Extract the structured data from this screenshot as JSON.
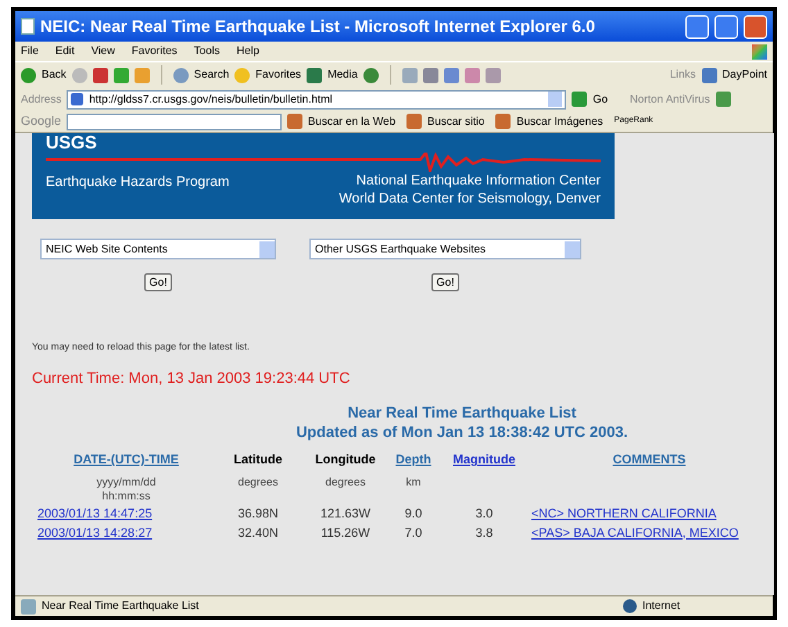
{
  "window": {
    "title": "NEIC: Near Real Time Earthquake List - Microsoft Internet Explorer 6.0"
  },
  "menu": [
    "File",
    "Edit",
    "View",
    "Favorites",
    "Tools",
    "Help"
  ],
  "toolbar": {
    "back": "Back",
    "search": "Search",
    "favorites": "Favorites",
    "media": "Media",
    "links_label": "Links",
    "links_item": "DayPoint"
  },
  "address_bar": {
    "label": "Address",
    "url": "http://gldss7.cr.usgs.gov/neis/bulletin/bulletin.html",
    "go": "Go",
    "norton": "Norton AntiVirus"
  },
  "google_bar": {
    "logo": "Google",
    "buttons": [
      "Buscar en la Web",
      "Buscar sitio",
      "Buscar Imágenes"
    ],
    "pagerank": "PageRank"
  },
  "banner": {
    "logo": "USGS",
    "program": "Earthquake Hazards Program",
    "center_lines": [
      "National Earthquake Information Center",
      "World Data Center for Seismology, Denver"
    ]
  },
  "selects": [
    {
      "value": "NEIC Web Site Contents",
      "button": "Go!"
    },
    {
      "value": "Other USGS Earthquake Websites",
      "button": "Go!"
    }
  ],
  "note": "You may need to reload this page for the latest list.",
  "current_time": "Current Time: Mon, 13 Jan 2003 19:23:44 UTC",
  "list_title": "Near Real Time Earthquake List",
  "updated": "Updated as of Mon Jan 13 18:38:42 UTC 2003.",
  "table": {
    "columns": [
      {
        "label": "DATE-(UTC)-TIME",
        "link": true,
        "unit": "yyyy/mm/dd hh:mm:ss"
      },
      {
        "label": "Latitude",
        "link": false,
        "unit": "degrees"
      },
      {
        "label": "Longitude",
        "link": false,
        "unit": "degrees"
      },
      {
        "label": "Depth",
        "link": true,
        "unit": "km"
      },
      {
        "label": "Magnitude",
        "link": true
      },
      {
        "label": "COMMENTS",
        "link": true
      }
    ],
    "rows": [
      {
        "datetime": "2003/01/13 14:47:25",
        "latitude": "36.98N",
        "longitude": "121.63W",
        "depth": "9.0",
        "magnitude": "3.0",
        "comment": "<NC> NORTHERN CALIFORNIA"
      },
      {
        "datetime": "2003/01/13 14:28:27",
        "latitude": "32.40N",
        "longitude": "115.26W",
        "depth": "7.0",
        "magnitude": "3.8",
        "comment": "<PAS> BAJA CALIFORNIA, MEXICO"
      }
    ]
  },
  "status_bar": {
    "text": "Near Real Time Earthquake List",
    "zone": "Internet"
  }
}
